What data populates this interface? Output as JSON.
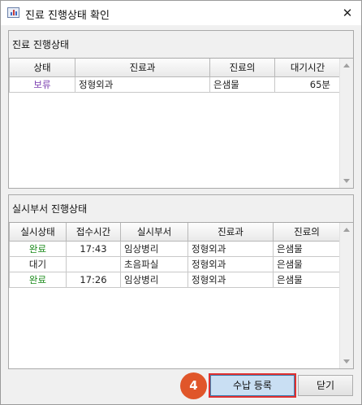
{
  "window": {
    "title": "진료 진행상태 확인",
    "close_glyph": "✕"
  },
  "treatment_group": {
    "title": "진료 진행상태",
    "columns": [
      "상태",
      "진료과",
      "진료의",
      "대기시간"
    ],
    "rows": [
      {
        "status": "보류",
        "department": "정형외과",
        "doctor": "은샘물",
        "wait_time": "65분"
      }
    ]
  },
  "dept_group": {
    "title": "실시부서 진행상태",
    "columns": [
      "실시상태",
      "접수시간",
      "실시부서",
      "진료과",
      "진료의"
    ],
    "rows": [
      {
        "status": "완료",
        "time": "17:43",
        "exec_dept": "임상병리",
        "department": "정형외과",
        "doctor": "은샘물"
      },
      {
        "status": "대기",
        "time": "",
        "exec_dept": "초음파실",
        "department": "정형외과",
        "doctor": "은샘물"
      },
      {
        "status": "완료",
        "time": "17:26",
        "exec_dept": "임상병리",
        "department": "정형외과",
        "doctor": "은샘물"
      }
    ]
  },
  "buttons": {
    "pay_register": "수납 등록",
    "close": "닫기"
  },
  "step_badge": "4",
  "colors": {
    "status_hold": "#7b3fb0",
    "status_done": "#1a8a1a",
    "badge": "#e0562a",
    "highlight_border": "#e03030"
  }
}
